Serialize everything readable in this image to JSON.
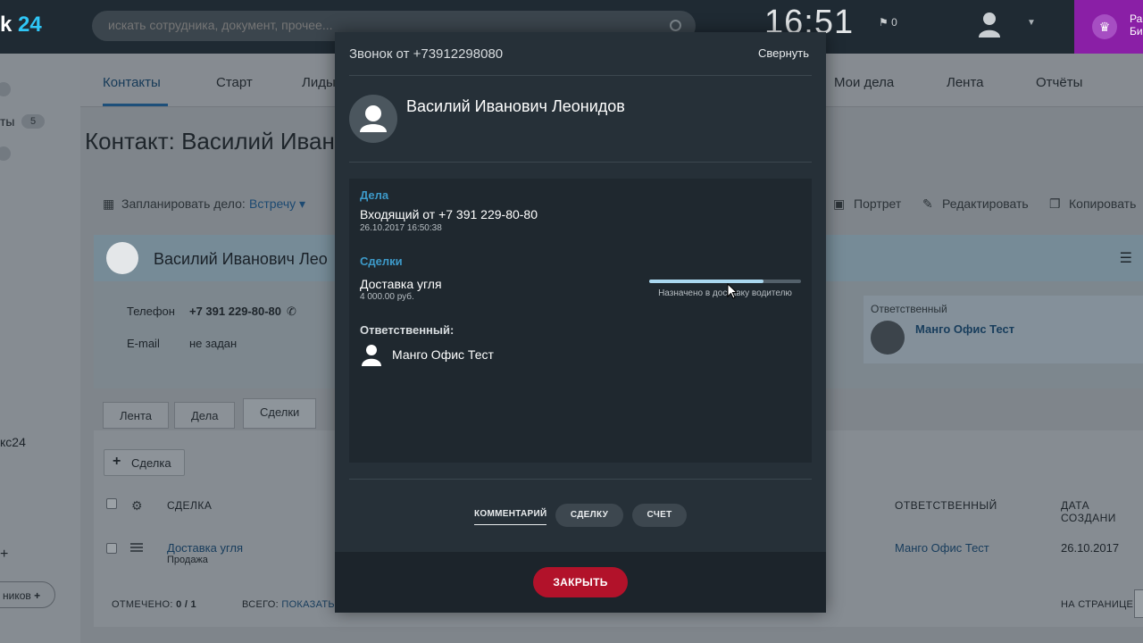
{
  "app": {
    "logo_text": "k",
    "logo_num": "24",
    "search_placeholder": "искать сотрудника, документ, прочее...",
    "clock": "16:51",
    "flag_count": "⚑ 0",
    "promo_line1": "Ра",
    "promo_line2": "Би",
    "colors": {
      "topbar": "#1f2a33",
      "accent": "#2fc6f6",
      "promo": "#8a1fa6",
      "close": "#b2122a",
      "section": "#3d9ac9"
    }
  },
  "leftnav": {
    "items": [
      {
        "label": "ты"
      },
      {
        "label": "кс24"
      },
      {
        "label": "ников"
      }
    ],
    "badge": "5"
  },
  "top_tabs": [
    "Контакты",
    "Старт",
    "Лиды",
    "Мои дела",
    "Лента",
    "Отчёты"
  ],
  "page_title": "Контакт: Василий Иван",
  "toolbar": {
    "plan_label": "Запланировать дело:",
    "plan_value": "Встречу",
    "portrait": "Портрет",
    "edit": "Редактировать",
    "copy": "Копировать"
  },
  "contact": {
    "name": "Василий Иванович Лео",
    "phone_label": "Телефон",
    "phone_value": "+7 391 229-80-80",
    "email_label": "E-mail",
    "email_value": "не задан",
    "responsible_label": "Ответственный",
    "responsible_name": "Манго Офис Тест"
  },
  "lower_tabs": [
    "Лента",
    "Дела",
    "Сделки"
  ],
  "grid": {
    "add_button": "Сделка",
    "headers": {
      "deal": "СДЕЛКА",
      "responsible": "ОТВЕТСТВЕННЫЙ",
      "created": "ДАТА СОЗДАНИ"
    },
    "rows": [
      {
        "deal": "Доставка угля",
        "type": "Продажа",
        "responsible": "Манго Офис Тест",
        "created": "26.10.2017"
      }
    ],
    "footer_selected_label": "ОТМЕЧЕНО:",
    "footer_selected_value": "0 / 1",
    "footer_total_label": "ВСЕГО:",
    "footer_total_link": "ПОКАЗАТЬ",
    "footer_per_page": "НА СТРАНИЦЕ:"
  },
  "modal": {
    "title": "Звонок от +73912298080",
    "collapse": "Свернуть",
    "caller_name": "Василий Иванович Леонидов",
    "tasks_section": "Дела",
    "task_title": "Входящий от +7 391 229-80-80",
    "task_time": "26.10.2017 16:50:38",
    "deals_section": "Сделки",
    "deal_title": "Доставка угля",
    "deal_amount": "4 000.00 руб.",
    "deal_stage": "Назначено в доставку водителю",
    "deal_progress": 0.75,
    "responsible_section": "Ответственный:",
    "responsible_name": "Манго Офис Тест",
    "actions": [
      "КОММЕНТАРИЙ",
      "СДЕЛКУ",
      "СЧЕТ"
    ],
    "close": "ЗАКРЫТЬ"
  }
}
